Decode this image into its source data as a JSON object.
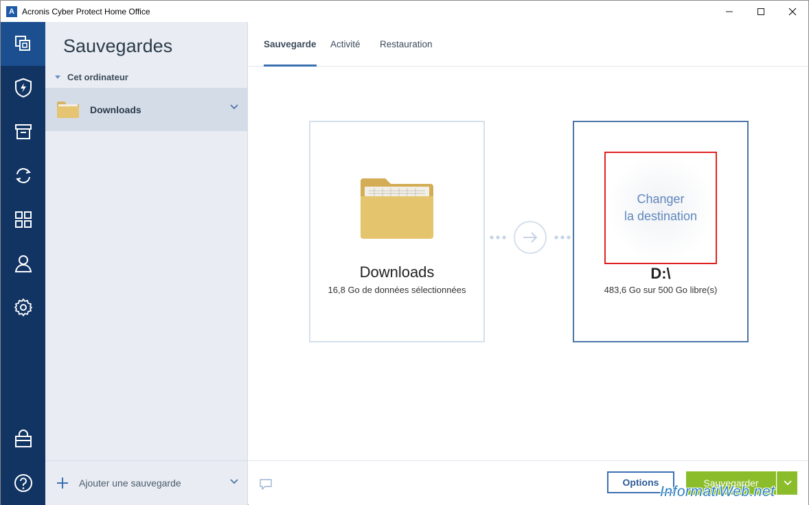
{
  "window": {
    "title": "Acronis Cyber Protect Home Office",
    "logo_letter": "A"
  },
  "sidebar": {
    "title": "Sauvegardes",
    "group_label": "Cet ordinateur",
    "items": [
      {
        "label": "Downloads"
      }
    ],
    "add_label": "Ajouter une sauvegarde"
  },
  "tabs": [
    {
      "label": "Sauvegarde",
      "active": true
    },
    {
      "label": "Activité",
      "active": false
    },
    {
      "label": "Restauration",
      "active": false
    }
  ],
  "source": {
    "name": "Downloads",
    "details": "16,8 Go de données sélectionnées"
  },
  "destination": {
    "change_line1": "Changer",
    "change_line2": "la destination",
    "name": "D:\\",
    "details": "483,6 Go sur 500 Go libre(s)"
  },
  "buttons": {
    "options": "Options",
    "save": "Sauvegarder"
  },
  "watermark": "InformatiWeb.net",
  "colors": {
    "rail": "#113463",
    "rail_active": "#1b4f8f",
    "accent": "#3a6fb0",
    "save_green": "#8bbd2b",
    "highlight_red": "#e02020"
  }
}
